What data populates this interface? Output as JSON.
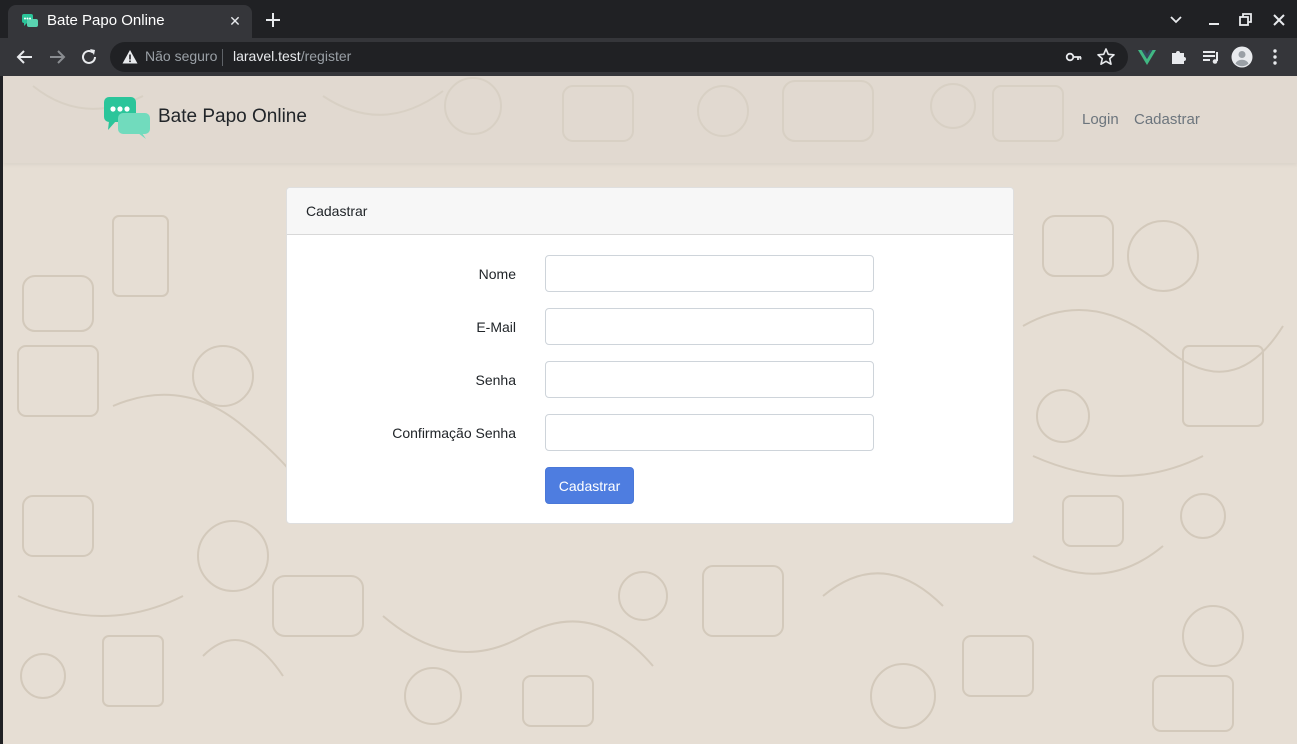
{
  "browser": {
    "tab": {
      "title": "Bate Papo Online"
    },
    "address_bar": {
      "security_label": "Não seguro",
      "host": "laravel.test",
      "path": "/register"
    }
  },
  "navbar": {
    "brand": "Bate Papo Online",
    "links": {
      "login": "Login",
      "register": "Cadastrar"
    }
  },
  "card": {
    "header": "Cadastrar",
    "fields": {
      "name": {
        "label": "Nome",
        "value": ""
      },
      "email": {
        "label": "E-Mail",
        "value": ""
      },
      "password": {
        "label": "Senha",
        "value": ""
      },
      "password_confirm": {
        "label": "Confirmação Senha",
        "value": ""
      }
    },
    "submit_label": "Cadastrar"
  },
  "colors": {
    "brand_green": "#2bc59a",
    "button_blue": "#4e7de0",
    "page_bg": "#e6ded4",
    "vue_green": "#41b883"
  },
  "icons": [
    "chat-bubbles-icon",
    "close-icon",
    "plus-icon",
    "chevron-down-icon",
    "minimize-icon",
    "restore-icon",
    "back-arrow-icon",
    "forward-arrow-icon",
    "reload-icon",
    "warning-icon",
    "key-icon",
    "star-icon",
    "vue-devtools-icon",
    "puzzle-icon",
    "media-queue-icon",
    "profile-avatar-icon",
    "more-vert-icon"
  ]
}
